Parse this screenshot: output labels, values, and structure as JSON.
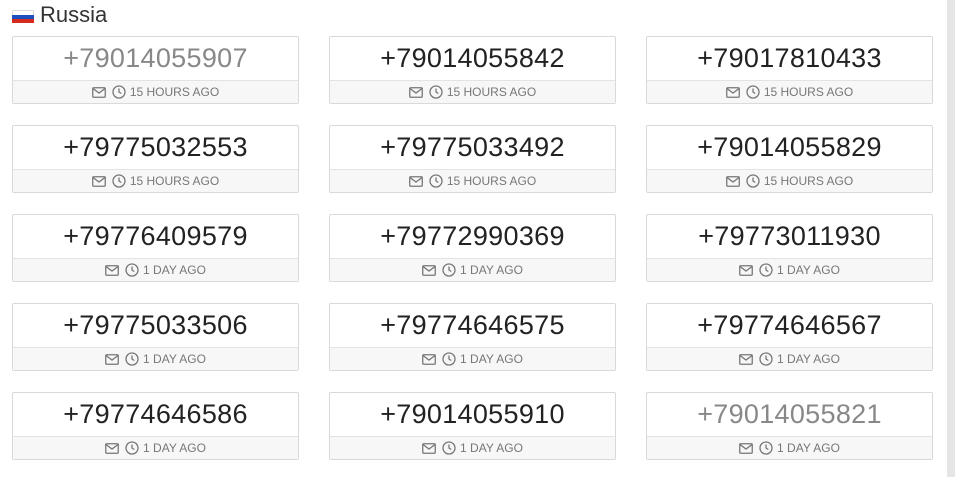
{
  "section": {
    "country": "Russia",
    "flag_icon": "russia-flag-icon"
  },
  "cards": [
    {
      "number": "+79014055907",
      "time": "15 HOURS AGO",
      "faded": true
    },
    {
      "number": "+79014055842",
      "time": "15 HOURS AGO",
      "faded": false
    },
    {
      "number": "+79017810433",
      "time": "15 HOURS AGO",
      "faded": false
    },
    {
      "number": "+79775032553",
      "time": "15 HOURS AGO",
      "faded": false
    },
    {
      "number": "+79775033492",
      "time": "15 HOURS AGO",
      "faded": false
    },
    {
      "number": "+79014055829",
      "time": "15 HOURS AGO",
      "faded": false
    },
    {
      "number": "+79776409579",
      "time": "1 DAY AGO",
      "faded": false
    },
    {
      "number": "+79772990369",
      "time": "1 DAY AGO",
      "faded": false
    },
    {
      "number": "+79773011930",
      "time": "1 DAY AGO",
      "faded": false
    },
    {
      "number": "+79775033506",
      "time": "1 DAY AGO",
      "faded": false
    },
    {
      "number": "+79774646575",
      "time": "1 DAY AGO",
      "faded": false
    },
    {
      "number": "+79774646567",
      "time": "1 DAY AGO",
      "faded": false
    },
    {
      "number": "+79774646586",
      "time": "1 DAY AGO",
      "faded": false
    },
    {
      "number": "+79014055910",
      "time": "1 DAY AGO",
      "faded": false
    },
    {
      "number": "+79014055821",
      "time": "1 DAY AGO",
      "faded": true
    }
  ],
  "icons": {
    "message": "envelope-icon",
    "time": "clock-icon"
  }
}
